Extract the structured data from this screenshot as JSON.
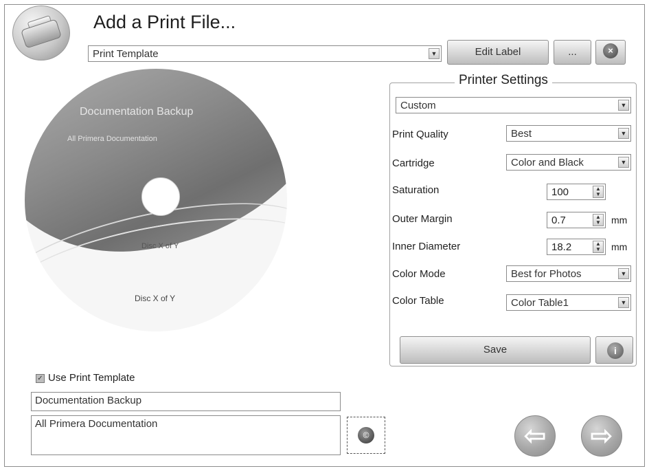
{
  "header": {
    "title": "Add a Print File...",
    "template_select": "Print Template",
    "edit_label_button": "Edit Label",
    "more_button": "...",
    "close_button": "×"
  },
  "disc": {
    "title": "Documentation Backup",
    "subtitle": "All Primera Documentation",
    "disc_number_upper": "Disc X of Y",
    "disc_number_lower": "Disc X of Y"
  },
  "printer_settings": {
    "title": "Printer Settings",
    "preset": "Custom",
    "fields": {
      "print_quality": {
        "label": "Print Quality",
        "value": "Best"
      },
      "cartridge": {
        "label": "Cartridge",
        "value": "Color and Black"
      },
      "saturation": {
        "label": "Saturation",
        "value": "100"
      },
      "outer_margin": {
        "label": "Outer Margin",
        "value": "0.7",
        "unit": "mm"
      },
      "inner_diameter": {
        "label": "Inner Diameter",
        "value": "18.2",
        "unit": "mm"
      },
      "color_mode": {
        "label": "Color Mode",
        "value": "Best for Photos"
      },
      "color_table": {
        "label": "Color Table",
        "value": "Color Table1"
      }
    },
    "save_button": "Save",
    "info_button": "i"
  },
  "bottom": {
    "use_template_label": "Use Print Template",
    "use_template_checked": true,
    "title_field": "Documentation Backup",
    "subtitle_field": "All Primera Documentation"
  },
  "navigation": {
    "back_icon": "left-arrow-icon",
    "next_icon": "right-arrow-icon"
  }
}
